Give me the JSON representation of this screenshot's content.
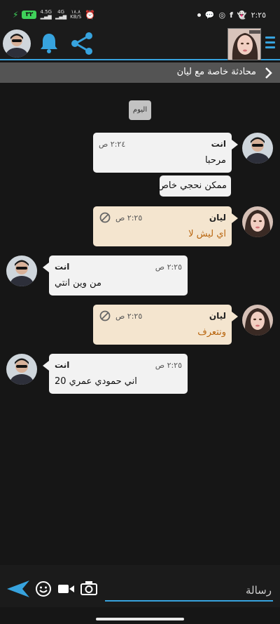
{
  "status_bar": {
    "battery": "٣٢",
    "network_1": "4.5G",
    "network_2": "4G",
    "speed_value": "١٨.٨",
    "speed_unit": "KB/S",
    "clock": "٢:٢٥"
  },
  "conversation": {
    "title": "محادثة خاصة مع ليان"
  },
  "date_chip": "اليوم",
  "messages": [
    {
      "sender": "انت",
      "time": "٢:٢٤ ص",
      "text": "مرحبا",
      "extra": "ممكن نحجي خاص"
    },
    {
      "sender": "ليان",
      "time": "٢:٢٥ ص",
      "text": "اي ليش لا"
    },
    {
      "sender": "انت",
      "time": "٢:٢٥ ص",
      "text": "من وين انتي"
    },
    {
      "sender": "ليان",
      "time": "٢:٢٥ ص",
      "text": "ونتعرف"
    },
    {
      "sender": "انت",
      "time": "٢:٢٥ ص",
      "text": "اني حمودي عمري 20"
    }
  ],
  "composer": {
    "placeholder": "رسالة"
  },
  "colors": {
    "accent": "#37a3de",
    "incoming_bubble": "#f4e5cf",
    "outgoing_bubble": "#f2f2f2",
    "incoming_text": "#b8650e",
    "battery": "#3fd15a"
  }
}
